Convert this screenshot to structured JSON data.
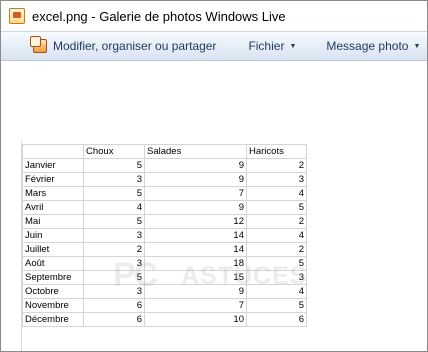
{
  "window": {
    "title": "excel.png - Galerie de photos Windows Live"
  },
  "toolbar": {
    "edit_label": "Modifier, organiser ou partager",
    "file_label": "Fichier",
    "message_label": "Message photo"
  },
  "watermark": {
    "rc": "PC",
    "text": "ASTUCES"
  },
  "sheet": {
    "headers": [
      "",
      "Choux",
      "Salades",
      "Haricots"
    ],
    "rows": [
      [
        "Janvier",
        "5",
        "9",
        "2"
      ],
      [
        "Février",
        "3",
        "9",
        "3"
      ],
      [
        "Mars",
        "5",
        "7",
        "4"
      ],
      [
        "Avril",
        "4",
        "9",
        "5"
      ],
      [
        "Mai",
        "5",
        "12",
        "2"
      ],
      [
        "Juin",
        "3",
        "14",
        "4"
      ],
      [
        "Juillet",
        "2",
        "14",
        "2"
      ],
      [
        "Août",
        "3",
        "18",
        "5"
      ],
      [
        "Septembre",
        "5",
        "15",
        "3"
      ],
      [
        "Octobre",
        "3",
        "9",
        "4"
      ],
      [
        "Novembre",
        "6",
        "7",
        "5"
      ],
      [
        "Décembre",
        "6",
        "10",
        "6"
      ]
    ]
  },
  "colors": {
    "toolbar_text": "#1e395b",
    "grid_line": "#d4d4d4"
  }
}
